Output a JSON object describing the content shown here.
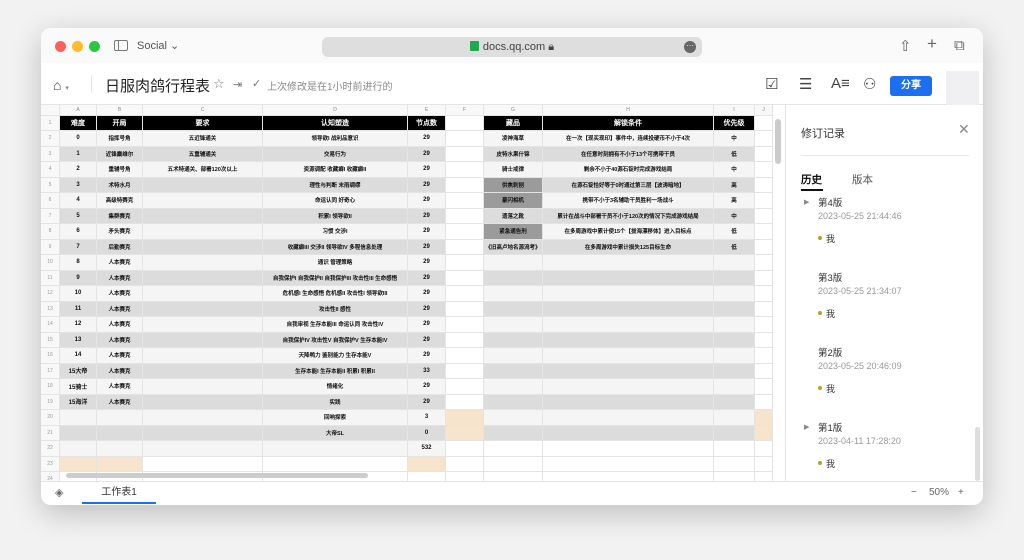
{
  "browser": {
    "profile": "Social",
    "url": "docs.qq.com"
  },
  "doc": {
    "title": "日服肉鸽行程表",
    "last_modified": "上次修改是在1小时前进行的",
    "share_label": "分享"
  },
  "colors": {
    "accent": "#1d6ff2",
    "header_bg": "#000000",
    "row_light": "#f5f5f5",
    "row_dark": "#dcdcdc",
    "g_dark": "#9b9b9b",
    "peach": "#f6e4cc"
  },
  "columns": [
    "A",
    "B",
    "C",
    "D",
    "E",
    "F",
    "G",
    "H",
    "I",
    "J"
  ],
  "headers": {
    "left": [
      "难度",
      "开局",
      "要求",
      "认知塑造",
      "节点数"
    ],
    "right": [
      "藏品",
      "解锁条件",
      "优先级"
    ]
  },
  "rows_left": [
    [
      "0",
      "指挥号角",
      "五近锋通关",
      "领导欲I 战利品意识",
      "29"
    ],
    [
      "1",
      "近锋麋维尔",
      "五重辅通关",
      "交易行为",
      "29"
    ],
    [
      "2",
      "重辅号角",
      "五术特通关、部署120次以上",
      "资源调配 收藏癖I 收藏癖II",
      "29"
    ],
    [
      "3",
      "术特水月",
      "",
      "理性与判断 末雨绸缪",
      "29"
    ],
    [
      "4",
      "高级特赛克",
      "",
      "命运认同 好奇心",
      "29"
    ],
    [
      "5",
      "集群赛克",
      "",
      "积累I 领导欲II",
      "29"
    ],
    [
      "6",
      "矛头赛克",
      "",
      "习惯 交涉I",
      "29"
    ],
    [
      "7",
      "后勤赛克",
      "",
      "收藏癖III 交涉II 领导欲IV 多程信息处理",
      "29"
    ],
    [
      "8",
      "人本赛克",
      "",
      "通识 管理策略",
      "29"
    ],
    [
      "9",
      "人本赛克",
      "",
      "自我保护I 自我保护II 自我保护III 攻击性III 生命感悟",
      "29"
    ],
    [
      "10",
      "人本赛克",
      "",
      "危机感I 生命感悟 危机感II 攻击性I 领导欲III",
      "29"
    ],
    [
      "11",
      "人本赛克",
      "",
      "攻击性II 感性",
      "29"
    ],
    [
      "12",
      "人本赛克",
      "",
      "自我审视 生存本能III 命运认同 攻击性IV",
      "29"
    ],
    [
      "13",
      "人本赛克",
      "",
      "自我保护IV 攻击性V 自我保护V 生存本能IV",
      "29"
    ],
    [
      "14",
      "人本赛克",
      "",
      "天降鸭力 鉴别能力 生存本能V",
      "29"
    ],
    [
      "15大帝",
      "人本赛克",
      "",
      "生存本能I 生存本能II 积累I 积累II",
      "33"
    ],
    [
      "15骑士",
      "人本赛克",
      "",
      "情绪化",
      "29"
    ],
    [
      "15海洋",
      "人本赛克",
      "",
      "实践",
      "29"
    ],
    [
      "",
      "",
      "",
      "回响探索",
      "3"
    ],
    [
      "",
      "",
      "",
      "大帝SL",
      "0"
    ],
    [
      "",
      "",
      "",
      "",
      "532"
    ]
  ],
  "rows_right": [
    [
      "凌神海草",
      "在一次【现买现印】事件中，连续投硬币不小于4次",
      "中"
    ],
    [
      "皮特水果什锦",
      "在任意时刻拥有不小于13个可携带干员",
      "低"
    ],
    [
      "骑士戒律",
      "剩余不小于40源石锭时完成游戏结局",
      "中"
    ],
    [
      "供焦刺刨",
      "在源石锭恰好等于0时通过第三层【波涛暗地】",
      "高"
    ],
    [
      "豪闪相机",
      "携带不小于3名辅助干员胜利一场战斗",
      "高"
    ],
    [
      "遗落之靴",
      "累计在战斗中部署干员不小于120次的情况下完成游戏结局",
      "中"
    ],
    [
      "紧急通告刑",
      "在多周游戏中累计使15个【拔海漂移体】进入目标点",
      "低"
    ],
    [
      "《旧高卢地名源流考》",
      "在多周游戏中累计损失125目标生命",
      "低"
    ]
  ],
  "panel": {
    "title": "修订记录",
    "tabs": [
      "历史",
      "版本"
    ],
    "versions": [
      {
        "name": "第4版",
        "date": "2023-05-25 21:44:46",
        "author": "我"
      },
      {
        "name": "第3版",
        "date": "2023-05-25 21:34:07",
        "author": "我"
      },
      {
        "name": "第2版",
        "date": "2023-05-25 20:46:09",
        "author": "我"
      },
      {
        "name": "第1版",
        "date": "2023-04-11 17:28:20",
        "author": "我"
      }
    ]
  },
  "footer": {
    "sheet": "工作表1",
    "zoom": "50%"
  }
}
